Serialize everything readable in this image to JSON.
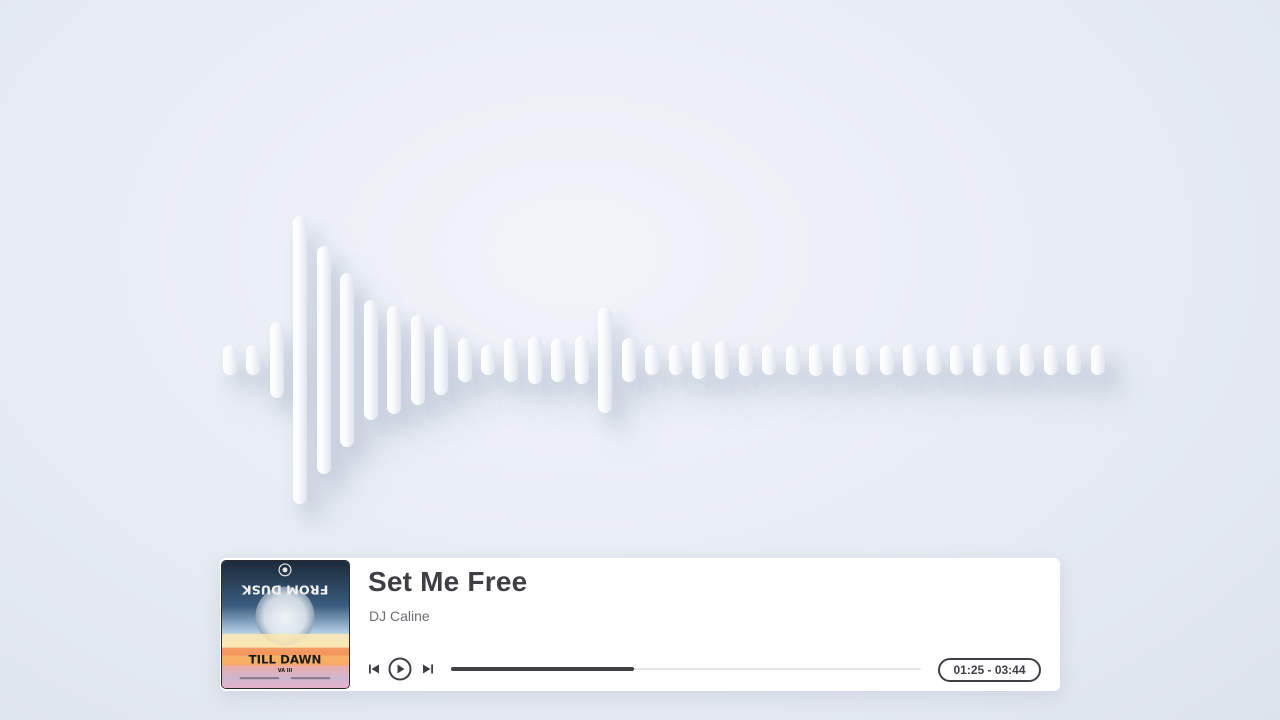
{
  "visualizer": {
    "levels": [
      0.05,
      0.05,
      0.22,
      1.0,
      0.78,
      0.58,
      0.38,
      0.34,
      0.27,
      0.2,
      0.1,
      0.05,
      0.1,
      0.12,
      0.1,
      0.12,
      0.33,
      0.1,
      0.05,
      0.05,
      0.08,
      0.08,
      0.06,
      0.05,
      0.05,
      0.06,
      0.06,
      0.05,
      0.05,
      0.06,
      0.05,
      0.05,
      0.06,
      0.05,
      0.06,
      0.05,
      0.05,
      0.05
    ],
    "bar_color": "#ffffff"
  },
  "track": {
    "title": "Set Me Free",
    "artist": "DJ Caline",
    "time_display": "01:25 - 03:44",
    "progress": 0.39
  },
  "album": {
    "top_text": "FROM DUSK",
    "bottom_text": "TILL DAWN",
    "volume_text": "VA III"
  },
  "controls": {
    "previous_icon": "skip-previous-icon",
    "play_icon": "play-circle-icon",
    "next_icon": "skip-next-icon"
  },
  "colors": {
    "text_primary": "#3d3f45",
    "text_secondary": "#6b6e74",
    "background": "#e7ecf3"
  }
}
